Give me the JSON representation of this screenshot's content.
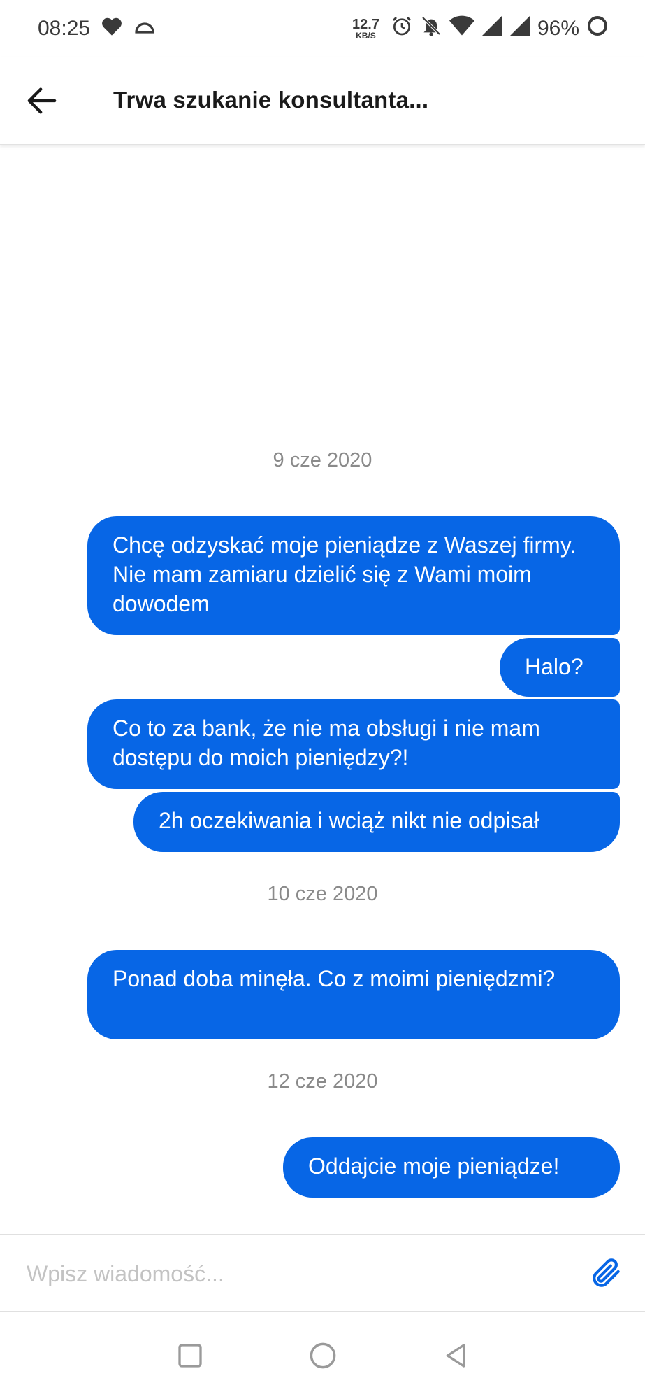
{
  "status_bar": {
    "time": "08:25",
    "net_speed_value": "12.7",
    "net_speed_unit": "KB/S",
    "battery": "96%",
    "icons": [
      "heart-icon",
      "cloud-icon",
      "alarm-icon",
      "bell-off-icon",
      "wifi-icon",
      "signal-icon",
      "signal-icon",
      "battery-ring-icon"
    ]
  },
  "header": {
    "title": "Trwa szukanie konsultanta..."
  },
  "chat": {
    "groups": [
      {
        "date": "9 cze 2020",
        "messages": [
          "Chcę odzyskać moje pieniądze z Waszej firmy. Nie mam zamiaru dzielić się z Wami moim dowodem",
          "Halo?",
          "Co to za bank, że nie ma obsługi i nie mam dostępu do moich pieniędzy?!",
          "2h oczekiwania i wciąż nikt nie odpisał"
        ]
      },
      {
        "date": "10 cze 2020",
        "messages": [
          "Ponad doba minęła. Co z moimi pieniędzmi?"
        ]
      },
      {
        "date": "12 cze 2020",
        "messages": [
          "Oddajcie moje pieniądze!"
        ]
      }
    ]
  },
  "input": {
    "placeholder": "Wpisz wiadomość...",
    "value": ""
  },
  "colors": {
    "bubble": "#0766e6",
    "accent": "#0766e6",
    "date_text": "#8a8a8a"
  }
}
